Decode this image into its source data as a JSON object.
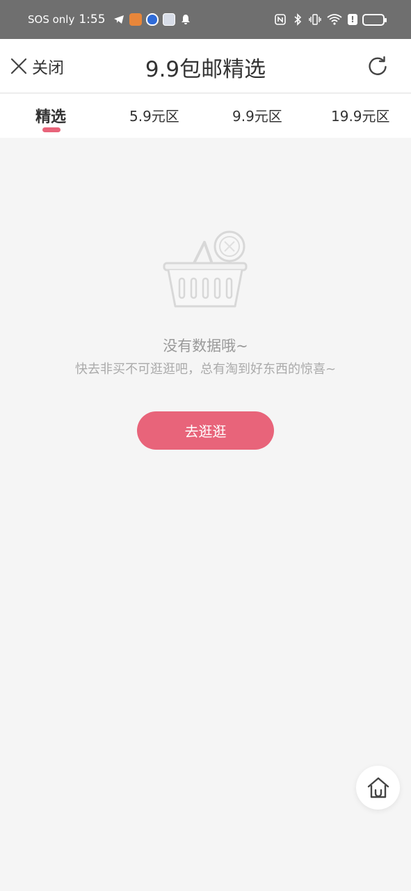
{
  "status_bar": {
    "carrier": "SOS only",
    "time": "1:55",
    "network": "6"
  },
  "header": {
    "close_label": "关闭",
    "title": "9.9包邮精选"
  },
  "tabs": [
    {
      "label": "精选",
      "active": true
    },
    {
      "label": "5.9元区",
      "active": false
    },
    {
      "label": "9.9元区",
      "active": false
    },
    {
      "label": "19.9元区",
      "active": false
    }
  ],
  "empty_state": {
    "title": "没有数据哦~",
    "subtitle": "快去非买不可逛逛吧，总有淘到好东西的惊喜~",
    "button_label": "去逛逛"
  },
  "colors": {
    "accent": "#e8647a",
    "status_bar_bg": "#6f6f6f",
    "page_bg": "#f5f5f5"
  }
}
